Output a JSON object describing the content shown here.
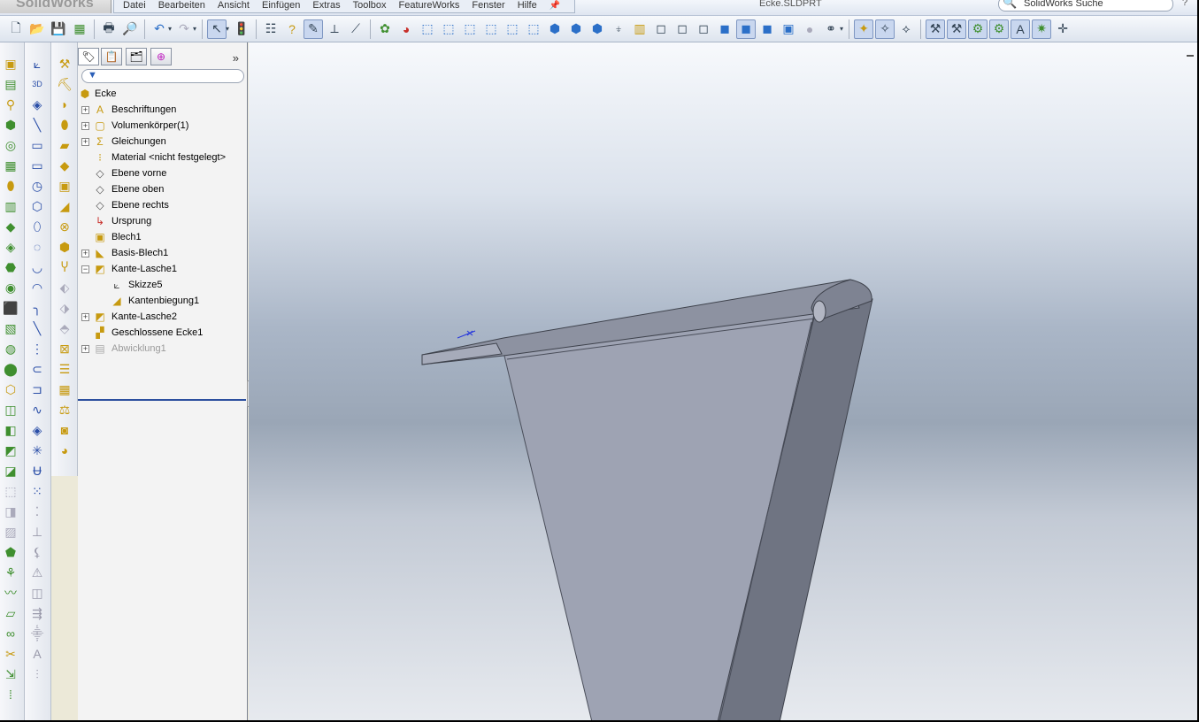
{
  "app": {
    "logo_text": "SolidWorks",
    "document_title": "Ecke.SLDPRT"
  },
  "menu": {
    "items": [
      "Datei",
      "Bearbeiten",
      "Ansicht",
      "Einfügen",
      "Extras",
      "Toolbox",
      "FeatureWorks",
      "Fenster",
      "Hilfe"
    ]
  },
  "search": {
    "placeholder": "SolidWorks Suche"
  },
  "help_label": "?",
  "toolbar": {
    "groups": [
      [
        "new-icon",
        "open-icon",
        "save-icon",
        "print-icon",
        "undo-icon",
        "redo-icon"
      ],
      [
        "select-icon",
        "rebuild-icon",
        "options-icon"
      ],
      [
        "view-orientation-icon",
        "appearance-icon",
        "display-style-icon"
      ]
    ]
  },
  "feature_manager": {
    "tabs": [
      "feature-manager-tab",
      "property-manager-tab",
      "configuration-manager-tab",
      "dimxpert-tab"
    ],
    "expand_glyph": "»",
    "filter_glyph": "▼",
    "root": "Ecke",
    "nodes": [
      {
        "label": "Beschriftungen",
        "icon": "annotations-icon",
        "expandable": true,
        "level": 0
      },
      {
        "label": "Volumenkörper(1)",
        "icon": "solid-bodies-icon",
        "expandable": true,
        "level": 0
      },
      {
        "label": "Gleichungen",
        "icon": "equations-icon",
        "expandable": true,
        "level": 0
      },
      {
        "label": "Material <nicht festgelegt>",
        "icon": "material-icon",
        "expandable": false,
        "level": 0
      },
      {
        "label": "Ebene vorne",
        "icon": "plane-icon",
        "expandable": false,
        "level": 0
      },
      {
        "label": "Ebene oben",
        "icon": "plane-icon",
        "expandable": false,
        "level": 0
      },
      {
        "label": "Ebene rechts",
        "icon": "plane-icon",
        "expandable": false,
        "level": 0
      },
      {
        "label": "Ursprung",
        "icon": "origin-icon",
        "expandable": false,
        "level": 0
      },
      {
        "label": "Blech1",
        "icon": "sheet-metal-icon",
        "expandable": false,
        "level": 0
      },
      {
        "label": "Basis-Blech1",
        "icon": "base-flange-icon",
        "expandable": true,
        "level": 0
      },
      {
        "label": "Kante-Lasche1",
        "icon": "edge-flange-icon",
        "expandable": true,
        "expanded": true,
        "level": 0
      },
      {
        "label": "Skizze5",
        "icon": "sketch-icon",
        "expandable": false,
        "level": 1
      },
      {
        "label": "Kantenbiegung1",
        "icon": "bend-icon",
        "expandable": false,
        "level": 1
      },
      {
        "label": "Kante-Lasche2",
        "icon": "edge-flange-icon",
        "expandable": true,
        "level": 0
      },
      {
        "label": "Geschlossene Ecke1",
        "icon": "closed-corner-icon",
        "expandable": false,
        "level": 0
      },
      {
        "label": "Abwicklung1",
        "icon": "flat-pattern-icon",
        "expandable": true,
        "level": 0,
        "suppressed": true
      }
    ]
  },
  "colors": {
    "rollback_bar": "#2c4f9e",
    "model_face": "#9ea3b3",
    "model_dark": "#6f7482",
    "model_top": "#8a8f9e"
  }
}
